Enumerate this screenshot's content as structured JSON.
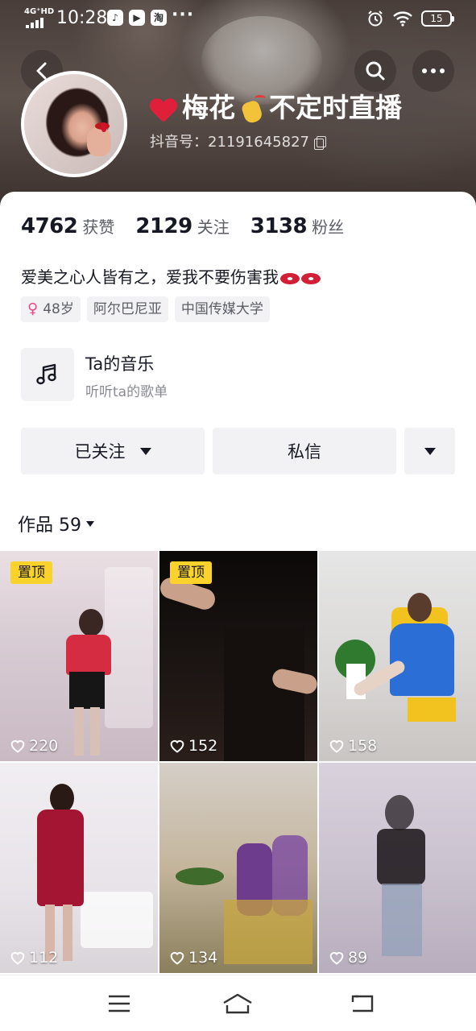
{
  "status_bar": {
    "network": "4G⁺HD",
    "time": "10:28",
    "app_icons": [
      "tiktok-icon",
      "video-icon",
      "taobao-icon"
    ],
    "taobao_glyph": "淘",
    "more": "···",
    "battery": "15"
  },
  "profile": {
    "nickname": "梅花",
    "nickname_suffix": "不定时直播",
    "douyin_id": "抖音号：21191645827"
  },
  "stats": [
    {
      "value": "4762",
      "label": "获赞"
    },
    {
      "value": "2129",
      "label": "关注"
    },
    {
      "value": "3138",
      "label": "粉丝"
    }
  ],
  "bio": "爱美之心人皆有之，爱我不要伤害我",
  "tags": [
    {
      "icon": "female-icon",
      "text": "48岁"
    },
    {
      "text": "阿尔巴尼亚"
    },
    {
      "text": "中国传媒大学"
    }
  ],
  "music": {
    "title": "Ta的音乐",
    "subtitle": "听听ta的歌单"
  },
  "buttons": {
    "followed": "已关注",
    "message": "私信"
  },
  "works": {
    "label": "作品 59"
  },
  "videos": [
    {
      "likes": "220",
      "pinned": true,
      "pin_label": "置顶"
    },
    {
      "likes": "152",
      "pinned": true,
      "pin_label": "置顶"
    },
    {
      "likes": "158",
      "pinned": false
    },
    {
      "likes": "112",
      "pinned": false
    },
    {
      "likes": "134",
      "pinned": false
    },
    {
      "likes": "89",
      "pinned": false
    }
  ],
  "colors": {
    "pin_badge": "#fbd22c",
    "text_primary": "#161823",
    "text_secondary": "#5c5e66",
    "chip_bg": "#f2f2f4"
  }
}
